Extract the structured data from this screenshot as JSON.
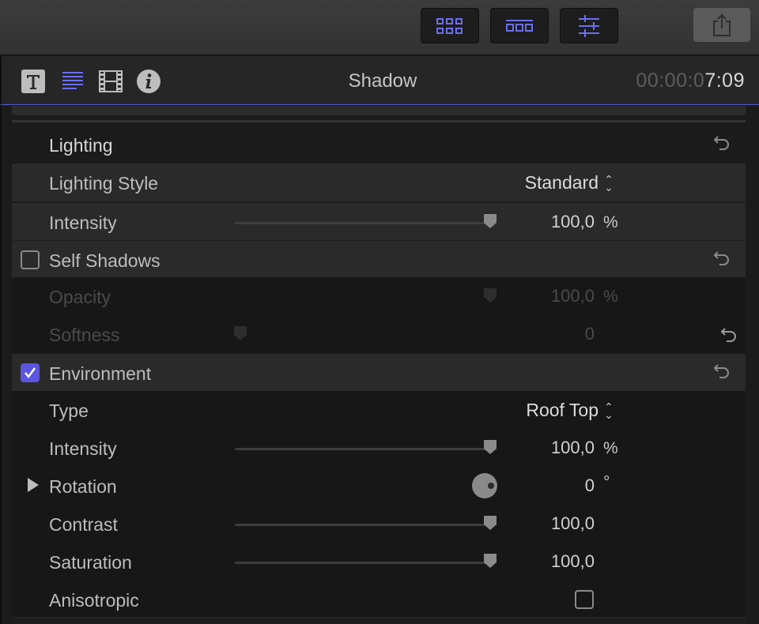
{
  "toolbar": {
    "buttons": [
      "browser-grid-icon",
      "timeline-icon",
      "inspector-sliders-icon"
    ],
    "share_icon": "share-icon"
  },
  "header": {
    "tabs": [
      "text-icon",
      "paragraph-lines-icon",
      "film-strip-icon",
      "info-icon"
    ],
    "title": "Shadow",
    "timecode_dim": "00:00:0",
    "timecode_bright": "7:09",
    "accent": "#5558d0"
  },
  "lighting": {
    "label": "Lighting",
    "style_label": "Lighting Style",
    "style_value": "Standard",
    "intensity_label": "Intensity",
    "intensity_value": "100,0",
    "intensity_unit": "%",
    "intensity_level": 1.0
  },
  "self_shadows": {
    "label": "Self Shadows",
    "checked": false,
    "opacity_label": "Opacity",
    "opacity_value": "100,0",
    "opacity_unit": "%",
    "softness_label": "Softness",
    "softness_value": "0"
  },
  "environment": {
    "label": "Environment",
    "checked": true,
    "type_label": "Type",
    "type_value": "Roof Top",
    "intensity_label": "Intensity",
    "intensity_value": "100,0",
    "intensity_unit": "%",
    "rotation_label": "Rotation",
    "rotation_value": "0",
    "rotation_unit": "°",
    "contrast_label": "Contrast",
    "contrast_value": "100,0",
    "saturation_label": "Saturation",
    "saturation_value": "100,0",
    "anisotropic_label": "Anisotropic",
    "anisotropic_checked": false
  }
}
